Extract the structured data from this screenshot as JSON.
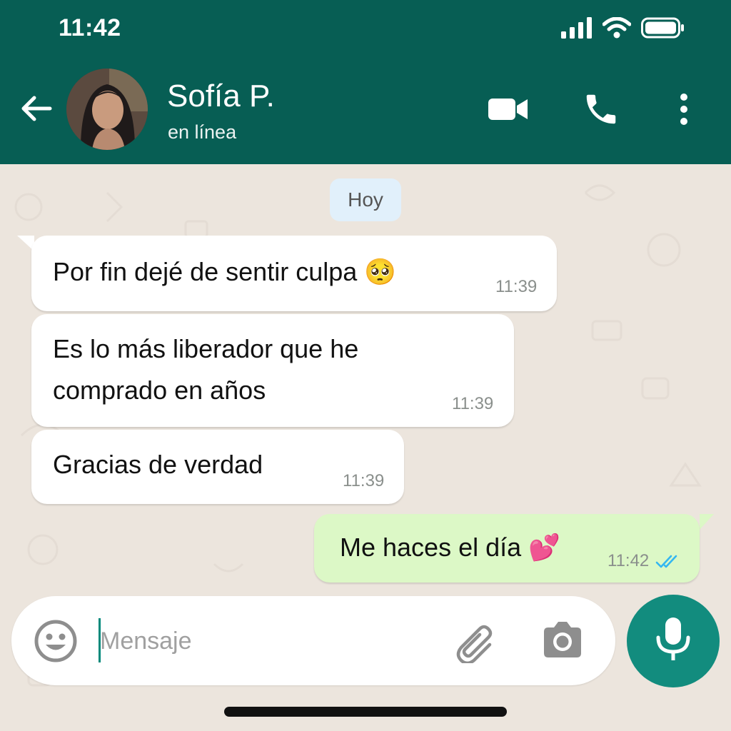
{
  "status_bar": {
    "time": "11:42"
  },
  "contact": {
    "name": "Sofía P.",
    "status": "en línea"
  },
  "chat": {
    "date_label": "Hoy",
    "messages": [
      {
        "direction": "incoming",
        "lines": [
          "Por fin dejé de sentir culpa 🥺"
        ],
        "time": "11:39"
      },
      {
        "direction": "incoming",
        "lines": [
          "Es lo más liberador que he",
          "comprado en años"
        ],
        "time": "11:39"
      },
      {
        "direction": "incoming",
        "lines": [
          "Gracias de verdad"
        ],
        "time": "11:39"
      },
      {
        "direction": "outgoing",
        "lines": [
          "Me haces el día 💕"
        ],
        "time": "11:42",
        "read_status": "double-check-read"
      }
    ]
  },
  "composer": {
    "placeholder": "Mensaje"
  },
  "icons": {
    "back": "arrow-left-icon",
    "video": "video-call-icon",
    "phone": "phone-icon",
    "menu": "more-vertical-icon",
    "emoji": "emoji-icon",
    "attach": "paperclip-icon",
    "camera": "camera-icon",
    "mic": "microphone-icon"
  },
  "colors": {
    "header": "#075e54",
    "chat_bg": "#ece5dd",
    "incoming_bubble": "#ffffff",
    "outgoing_bubble": "#dcf8c6",
    "mic_button": "#128c7e",
    "read_ticks": "#34b7f1"
  }
}
